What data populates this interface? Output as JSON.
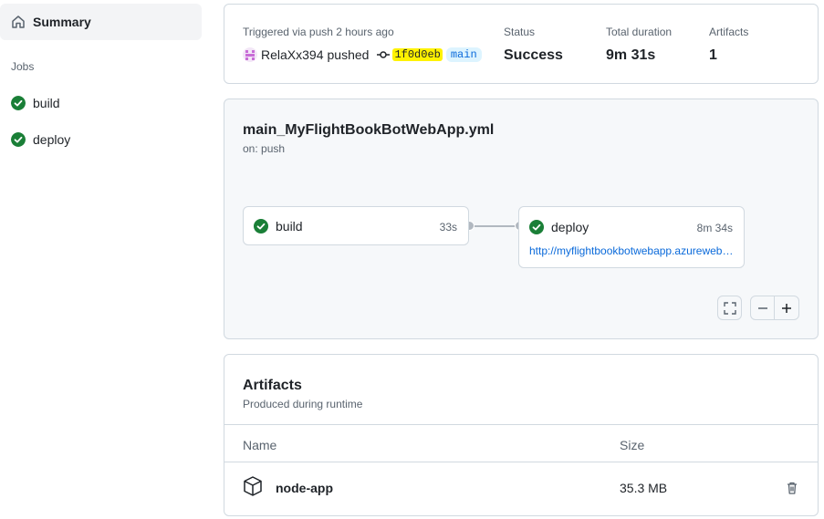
{
  "sidebar": {
    "summary_label": "Summary",
    "jobs_heading": "Jobs",
    "jobs": [
      {
        "label": "build"
      },
      {
        "label": "deploy"
      }
    ]
  },
  "run": {
    "trigger_text": "Triggered via push 2 hours ago",
    "actor": "RelaXx394",
    "pushed_text": "pushed",
    "commit_sha": "1f0d0eb",
    "branch": "main",
    "status_label": "Status",
    "status_value": "Success",
    "duration_label": "Total duration",
    "duration_value": "9m 31s",
    "artifacts_label": "Artifacts",
    "artifacts_value": "1"
  },
  "workflow": {
    "file": "main_MyFlightBookBotWebApp.yml",
    "event": "on: push",
    "build": {
      "label": "build",
      "duration": "33s"
    },
    "deploy": {
      "label": "deploy",
      "duration": "8m 34s",
      "url": "http://myflightbookbotwebapp.azurewebsites.net"
    }
  },
  "artifacts": {
    "title": "Artifacts",
    "subtitle": "Produced during runtime",
    "col_name": "Name",
    "col_size": "Size",
    "rows": [
      {
        "name": "node-app",
        "size": "35.3 MB"
      }
    ]
  },
  "colors": {
    "success": "#1a7f37",
    "link": "#0969da",
    "sha_highlight": "#fff200"
  }
}
